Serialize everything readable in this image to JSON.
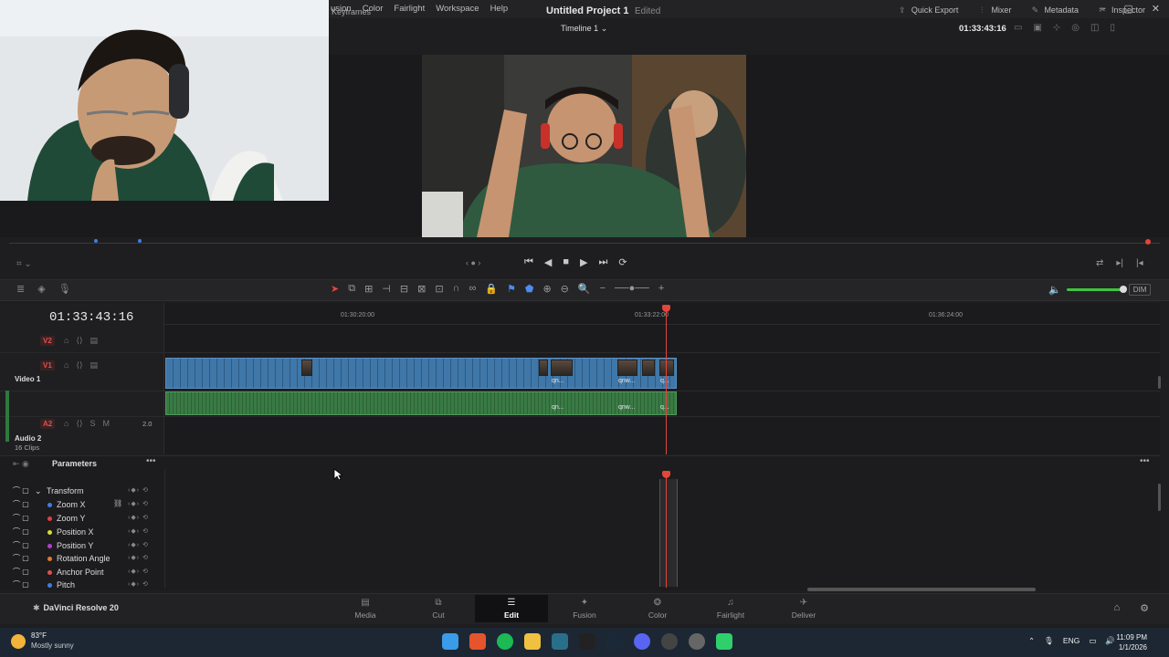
{
  "menu": [
    "usion",
    "Color",
    "Fairlight",
    "Workspace",
    "Help"
  ],
  "header": {
    "keyframes": "Keyframes",
    "project": "Untitled Project 1",
    "edited": "Edited",
    "timeline": "Timeline 1",
    "timecode": "01:33:43:16",
    "actions": [
      {
        "label": "Quick Export",
        "icon": "export-icon"
      },
      {
        "label": "Mixer",
        "icon": "mixer-icon"
      },
      {
        "label": "Metadata",
        "icon": "metadata-icon"
      },
      {
        "label": "Inspector",
        "icon": "inspector-icon"
      }
    ]
  },
  "timeline": {
    "timecode": "01:33:43:16",
    "ruler": [
      "01:30:20:00",
      "01:33:22:00",
      "01:36:24:00"
    ],
    "tracks": {
      "v2": "V2",
      "v1": "V1",
      "video1": "Video 1",
      "a2": "A2",
      "audio2": "Audio 2",
      "clips": "16 Clips",
      "a2_level": "2.0",
      "solo": "S",
      "mute": "M"
    },
    "clip_labels": [
      "qn...",
      "qnw...",
      "q..."
    ],
    "audio_labels": [
      "qn...",
      "qnw...",
      "q..."
    ]
  },
  "toolbar": {
    "dim": "DIM"
  },
  "parameters": {
    "title": "Parameters",
    "group": "Transform",
    "rows": [
      {
        "label": "Zoom X",
        "color": "#3f7fe0"
      },
      {
        "label": "Zoom Y",
        "color": "#e04040"
      },
      {
        "label": "Position X",
        "color": "#d9d93a"
      },
      {
        "label": "Position Y",
        "color": "#b040d0"
      },
      {
        "label": "Rotation Angle",
        "color": "#e07a30"
      },
      {
        "label": "Anchor Point",
        "color": "#e05050"
      },
      {
        "label": "Pitch",
        "color": "#3f7fe0"
      }
    ]
  },
  "brand": "DaVinci Resolve 20",
  "pages": [
    {
      "label": "Media",
      "icon": "media-icon"
    },
    {
      "label": "Cut",
      "icon": "cut-icon"
    },
    {
      "label": "Edit",
      "icon": "edit-icon",
      "active": true
    },
    {
      "label": "Fusion",
      "icon": "fusion-icon"
    },
    {
      "label": "Color",
      "icon": "color-icon"
    },
    {
      "label": "Fairlight",
      "icon": "fairlight-icon"
    },
    {
      "label": "Deliver",
      "icon": "deliver-icon"
    }
  ],
  "taskbar": {
    "temp": "83°F",
    "weather": "Mostly sunny",
    "lang": "ENG",
    "time": "11:09 PM",
    "date": "1/1/2026"
  }
}
